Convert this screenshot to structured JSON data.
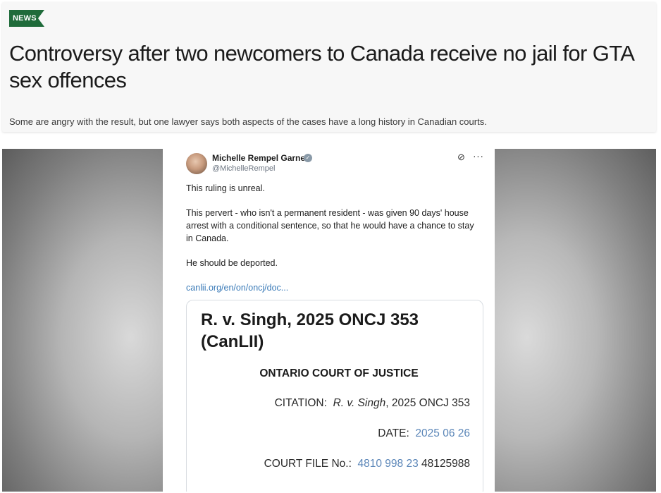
{
  "article": {
    "tag": "NEWS",
    "headline": "Controversy after two newcomers to Canada receive no jail for GTA sex offences",
    "subhead": "Some are angry with the result, but one lawyer says both aspects of the cases have a long history in Canadian courts."
  },
  "tweet": {
    "author_name": "Michelle Rempel Garner",
    "author_handle": "@MichelleRempel",
    "paragraphs": [
      "This ruling is unreal.",
      "This pervert - who isn't a permanent resident - was given 90 days' house arrest with a conditional sentence, so that he would have a chance to stay in Canada.",
      "He should be deported."
    ],
    "link_text": "canlii.org/en/on/oncj/doc...",
    "card": {
      "case_title": "R. v. Singh, 2025 ONCJ 353 (CanLII)",
      "court_name": "ONTARIO COURT OF JUSTICE",
      "citation_label": "CITATION:",
      "citation_case": "R. v. Singh",
      "citation_rest": ", 2025 ONCJ 353",
      "date_label": "DATE:",
      "date_value": "2025 06 26",
      "file_label": "COURT FILE No.:",
      "file_value_blue": "4810 998 23",
      "file_value_rest": "48125988"
    }
  },
  "colors": {
    "news_tag": "#1f6b3a",
    "link": "#3b7bb8",
    "date_blue": "#5b86b8"
  },
  "icons": {
    "verified": "verified-badge-icon",
    "grok": "grok-icon",
    "more": "more-options-icon"
  }
}
